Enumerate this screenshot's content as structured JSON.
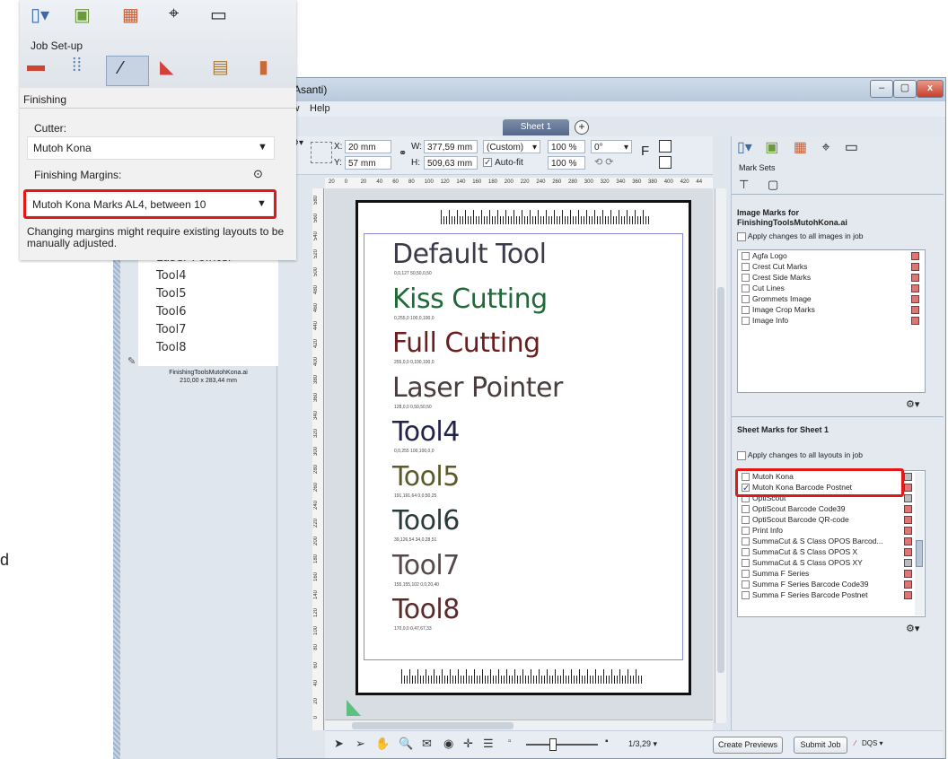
{
  "window": {
    "title": "(Asanti)",
    "min": "–",
    "max": "▢",
    "close": "x"
  },
  "menu": {
    "items": [
      "low",
      "Help"
    ]
  },
  "tabs": {
    "sheet": "Sheet 1",
    "add": "+"
  },
  "toolbar": {
    "x_label": "X:",
    "x_value": "20 mm",
    "y_label": "Y:",
    "y_value": "57 mm",
    "w_label": "W:",
    "w_value": "377,59 mm",
    "h_label": "H:",
    "h_value": "509,63 mm",
    "size_preset": "(Custom)",
    "autofit_label": "Auto-fit",
    "scale_w": "100 %",
    "scale_h": "100 %",
    "rotation": "0°",
    "flip_label": "F"
  },
  "ruler": {
    "h_ticks": [
      "20",
      "0",
      "20",
      "40",
      "60",
      "80",
      "100",
      "120",
      "140",
      "160",
      "180",
      "200",
      "220",
      "240",
      "260",
      "280",
      "300",
      "320",
      "340",
      "360",
      "380",
      "400",
      "420",
      "44"
    ],
    "v_ticks": [
      "580",
      "560",
      "540",
      "520",
      "500",
      "480",
      "460",
      "440",
      "420",
      "400",
      "380",
      "360",
      "340",
      "320",
      "300",
      "280",
      "260",
      "240",
      "220",
      "200",
      "180",
      "160",
      "140",
      "120",
      "100",
      "80",
      "60",
      "40",
      "20",
      "0"
    ]
  },
  "sheet_tools": [
    {
      "name": "Default Tool",
      "values": "0,0,127     50,50,0,50",
      "color": "#3a3a4a",
      "size": 30
    },
    {
      "name": "Kiss Cutting",
      "values": "0,255,0     100,0,100,0",
      "color": "#1f6a38",
      "size": 30
    },
    {
      "name": "Full Cutting",
      "values": "255,0,0     0,100,100,0",
      "color": "#6a1e1e",
      "size": 30
    },
    {
      "name": "Laser Pointer",
      "values": "128,0,0     0,50,50,50",
      "color": "#4a3c3c",
      "size": 30
    },
    {
      "name": "Tool4",
      "values": "0,0,255     100,100,0,0",
      "color": "#22224a",
      "size": 30
    },
    {
      "name": "Tool5",
      "values": "191,191,64     0,0,50,25",
      "color": "#5a5a2a",
      "size": 30
    },
    {
      "name": "Tool6",
      "values": "39,126,54     34,0,28,51",
      "color": "#2a3a3a",
      "size": 30
    },
    {
      "name": "Tool7",
      "values": "155,155,102     0,0,20,40",
      "color": "#554a4a",
      "size": 30
    },
    {
      "name": "Tool8",
      "values": "170,0,0     0,47,67,33",
      "color": "#5a2a2a",
      "size": 30
    }
  ],
  "bottom": {
    "zoom": "1/3,29 ▾",
    "create_previews": "Create Previews",
    "submit_job": "Submit Job",
    "dqs": "DQS ▾"
  },
  "right_panel": {
    "section": "Mark Sets",
    "image_marks_title_1": "Image Marks for",
    "image_marks_title_2": "FinishingToolsMutohKona.ai",
    "apply_images": "Apply changes to all images in job",
    "image_marks": [
      "Agfa Logo",
      "Crest Cut Marks",
      "Crest Side Marks",
      "Cut Lines",
      "Grommets Image",
      "Image Crop Marks",
      "Image Info"
    ],
    "sheet_marks_title": "Sheet Marks for Sheet 1",
    "apply_layouts": "Apply changes to all layouts in job",
    "sheet_marks": [
      {
        "label": "Mutoh Kona",
        "checked": false,
        "swatch": "b"
      },
      {
        "label": "Mutoh Kona Barcode Postnet",
        "checked": true,
        "swatch": "r"
      },
      {
        "label": "OptiScout",
        "checked": false,
        "swatch": "b"
      },
      {
        "label": "OptiScout Barcode Code39",
        "checked": false,
        "swatch": "r"
      },
      {
        "label": "OptiScout Barcode QR-code",
        "checked": false,
        "swatch": "r"
      },
      {
        "label": "Print Info",
        "checked": false,
        "swatch": "r"
      },
      {
        "label": "SummaCut & S Class OPOS Barcod...",
        "checked": false,
        "swatch": "r"
      },
      {
        "label": "SummaCut & S Class OPOS X",
        "checked": false,
        "swatch": "r"
      },
      {
        "label": "SummaCut & S Class OPOS XY",
        "checked": false,
        "swatch": "b"
      },
      {
        "label": "Summa F Series",
        "checked": false,
        "swatch": "r"
      },
      {
        "label": "Summa F Series Barcode Code39",
        "checked": false,
        "swatch": "r"
      },
      {
        "label": "Summa F Series Barcode Postnet",
        "checked": false,
        "swatch": "r"
      }
    ]
  },
  "left_panel": {
    "tools": [
      "Laser Pointer",
      "Tool4",
      "Tool5",
      "Tool6",
      "Tool7",
      "Tool8"
    ],
    "file_name": "FinishingToolsMutohKona.ai",
    "file_size": "210,00 x 283,44 mm",
    "edge_char": "d"
  },
  "popup": {
    "job_setup": "Job Set-up",
    "finishing": "Finishing",
    "cutter_label": "Cutter:",
    "cutter_value": "Mutoh Kona",
    "margins_label": "Finishing Margins:",
    "margins_value": "Mutoh Kona Marks AL4, between 10",
    "note": "Changing margins might require existing layouts to be manually adjusted."
  }
}
